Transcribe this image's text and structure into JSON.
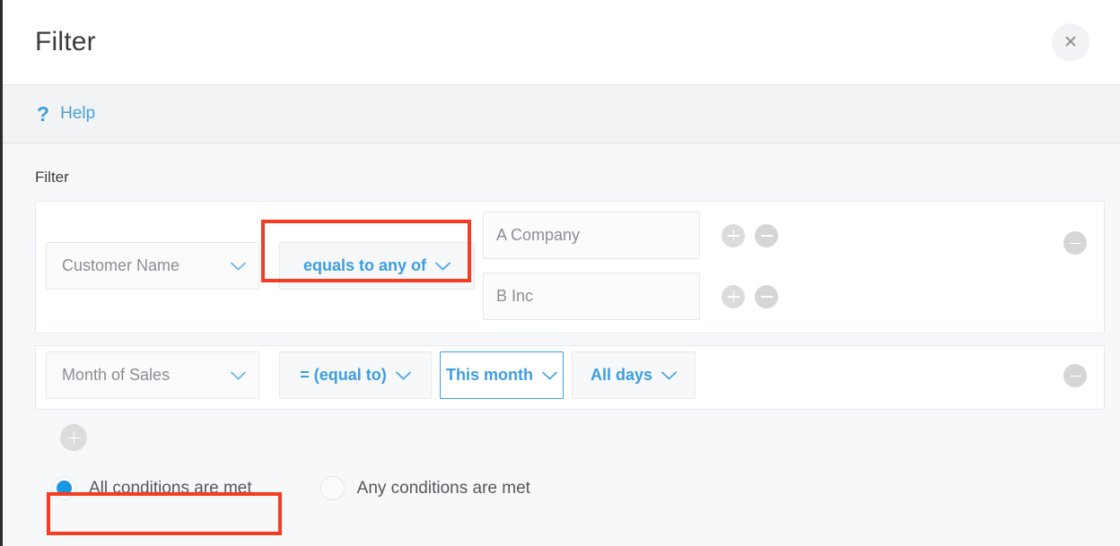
{
  "header": {
    "title": "Filter",
    "close_icon": "close-icon"
  },
  "helpbar": {
    "icon": "question-mark-icon",
    "icon_glyph": "?",
    "link_label": "Help"
  },
  "content": {
    "section_label": "Filter"
  },
  "conditions": [
    {
      "field": "Customer Name",
      "operator": "equals to any of",
      "operator_highlighted": true,
      "values": [
        "A Company",
        "B Inc"
      ],
      "remove_row_icon": "minus-circle-icon"
    },
    {
      "field": "Month of Sales",
      "operator": "= (equal to)",
      "period": "This month",
      "period_focused": true,
      "days": "All days",
      "remove_row_icon": "minus-circle-icon"
    }
  ],
  "value_row_buttons": {
    "add_icon": "plus-circle-icon",
    "remove_icon": "minus-circle-icon"
  },
  "add_condition": {
    "icon": "plus-circle-icon"
  },
  "match_mode": {
    "selected": "all",
    "options": [
      {
        "id": "all",
        "label": "All conditions are met",
        "checked": true,
        "highlighted": true
      },
      {
        "id": "any",
        "label": "Any conditions are met",
        "checked": false,
        "highlighted": false
      }
    ]
  },
  "colors": {
    "accent_blue": "#3c9ee0",
    "radio_blue": "#1b96e0",
    "annotation_red": "#f43d20",
    "page_background": "#f7f8fa",
    "card_background": "#ffffff"
  }
}
